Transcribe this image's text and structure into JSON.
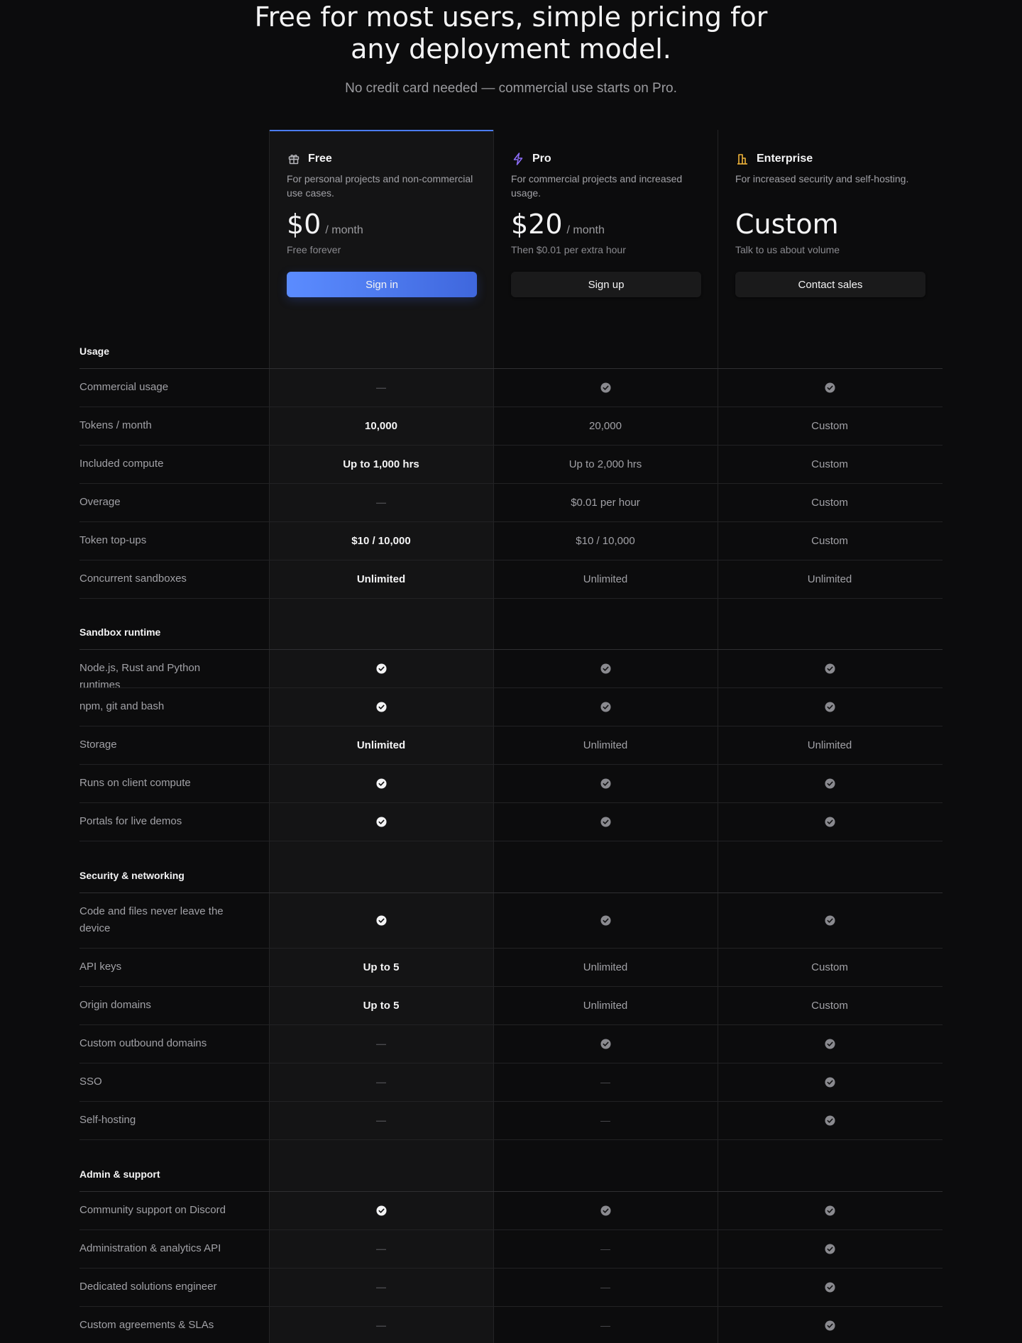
{
  "hero": {
    "title_line1": "Free for most users, simple pricing for",
    "title_line2": "any deployment model.",
    "subtitle": "No credit card needed — commercial use starts on Pro."
  },
  "colors": {
    "accent": "#4b7cf3",
    "pro_icon": "#8b6cf6",
    "enterprise_icon": "#f0b43a"
  },
  "plans": [
    {
      "icon": "gift-icon",
      "name": "Free",
      "description": "For personal projects and non-commercial use cases.",
      "price": "$0",
      "per": "/ month",
      "note": "Free forever",
      "cta": "Sign in"
    },
    {
      "icon": "lightning-icon",
      "name": "Pro",
      "description": "For commercial projects and increased usage.",
      "price": "$20",
      "per": "/ month",
      "note": "Then $0.01 per extra hour",
      "cta": "Sign up"
    },
    {
      "icon": "building-icon",
      "name": "Enterprise",
      "description": "For increased security and self-hosting.",
      "price": "Custom",
      "per": "",
      "note": "Talk to us about volume",
      "cta": "Contact sales"
    }
  ],
  "sections": [
    {
      "title": "Usage",
      "rows": [
        {
          "label": "Commercial usage",
          "values": [
            "—",
            "check",
            "check"
          ]
        },
        {
          "label": "Tokens / month",
          "values": [
            "10,000",
            "20,000",
            "Custom"
          ]
        },
        {
          "label": "Included compute",
          "values": [
            "Up to 1,000 hrs",
            "Up to 2,000 hrs",
            "Custom"
          ]
        },
        {
          "label": "Overage",
          "values": [
            "—",
            "$0.01 per hour",
            "Custom"
          ]
        },
        {
          "label": "Token top-ups",
          "values": [
            "$10 / 10,000",
            "$10 / 10,000",
            "Custom"
          ]
        },
        {
          "label": "Concurrent sandboxes",
          "values": [
            "Unlimited",
            "Unlimited",
            "Unlimited"
          ]
        }
      ]
    },
    {
      "title": "Sandbox runtime",
      "rows": [
        {
          "label": "Node.js, Rust and Python runtimes",
          "values": [
            "check",
            "check",
            "check"
          ]
        },
        {
          "label": "npm, git and bash",
          "values": [
            "check",
            "check",
            "check"
          ]
        },
        {
          "label": "Storage",
          "values": [
            "Unlimited",
            "Unlimited",
            "Unlimited"
          ]
        },
        {
          "label": "Runs on client compute",
          "values": [
            "check",
            "check",
            "check"
          ]
        },
        {
          "label": "Portals for live demos",
          "values": [
            "check",
            "check",
            "check"
          ]
        }
      ]
    },
    {
      "title": "Security & networking",
      "rows": [
        {
          "label": "Code and files never leave the device",
          "values": [
            "check",
            "check",
            "check"
          ]
        },
        {
          "label": "API keys",
          "values": [
            "Up to 5",
            "Unlimited",
            "Custom"
          ]
        },
        {
          "label": "Origin domains",
          "values": [
            "Up to 5",
            "Unlimited",
            "Custom"
          ]
        },
        {
          "label": "Custom outbound domains",
          "values": [
            "—",
            "check",
            "check"
          ]
        },
        {
          "label": "SSO",
          "values": [
            "—",
            "—",
            "check"
          ]
        },
        {
          "label": "Self-hosting",
          "values": [
            "—",
            "—",
            "check"
          ]
        }
      ]
    },
    {
      "title": "Admin & support",
      "rows": [
        {
          "label": "Community support on Discord",
          "values": [
            "check",
            "check",
            "check"
          ]
        },
        {
          "label": "Administration & analytics API",
          "values": [
            "—",
            "—",
            "check"
          ]
        },
        {
          "label": "Dedicated solutions engineer",
          "values": [
            "—",
            "—",
            "check"
          ]
        },
        {
          "label": "Custom agreements & SLAs",
          "values": [
            "—",
            "—",
            "check"
          ]
        }
      ]
    }
  ]
}
